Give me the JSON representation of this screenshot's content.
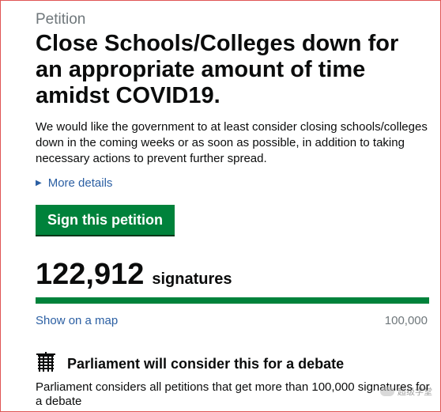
{
  "petition": {
    "kicker": "Petition",
    "title": "Close Schools/Colleges down for an appropriate amount of time amidst COVID19.",
    "description": "We would like the government to at least consider closing schools/colleges down in the coming weeks or as soon as possible, in addition to taking necessary actions to prevent further spread.",
    "more_details": "More details",
    "sign_button": "Sign this petition"
  },
  "signatures": {
    "count": "122,912",
    "label": "signatures",
    "progress_fraction": 1.0,
    "show_on_map": "Show on a map",
    "threshold": "100,000"
  },
  "debate": {
    "heading": "Parliament will consider this for a debate",
    "text": "Parliament considers all petitions that get more than 100,000 signatures for a debate"
  },
  "watermark": {
    "text": "超级学堂"
  },
  "colors": {
    "brand_green": "#00823b",
    "link_blue": "#2b5fa3",
    "border_red": "#e05555"
  },
  "icons": {
    "details_toggle": "triangle-right-icon",
    "debate": "portcullis-icon"
  }
}
